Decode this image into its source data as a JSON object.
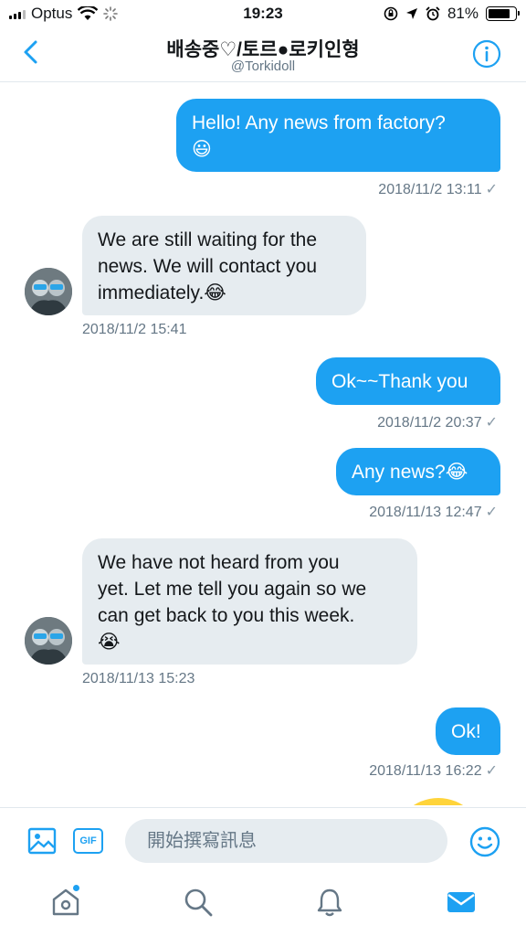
{
  "status_bar": {
    "carrier": "Optus",
    "time": "19:23",
    "battery": "81%",
    "battery_level": 0.81
  },
  "header": {
    "title": "배송중♡/토르●로키인형",
    "handle": "@Torkidoll"
  },
  "messages": [
    {
      "type": "sent",
      "lines": [
        "Hello! Any news from factory?",
        "😃"
      ],
      "timestamp": "2018/11/2 13:11"
    },
    {
      "type": "received",
      "lines": [
        "We are still waiting for the",
        "news. We will contact you",
        "immediately.😂"
      ],
      "timestamp": "2018/11/2 15:41"
    },
    {
      "type": "sent",
      "lines": [
        "Ok~~Thank you"
      ],
      "timestamp": "2018/11/2 20:37"
    },
    {
      "type": "sent",
      "lines": [
        "Any news?😂"
      ],
      "timestamp": "2018/11/13 12:47"
    },
    {
      "type": "received",
      "lines": [
        "We have not heard from you",
        "yet. Let me tell you again so we",
        "can get back to you this week.",
        "😭"
      ],
      "timestamp": "2018/11/13 15:23"
    },
    {
      "type": "sent",
      "lines": [
        "Ok!"
      ],
      "timestamp": "2018/11/13 16:22"
    }
  ],
  "composer": {
    "gif_label": "GIF",
    "placeholder": "開始撰寫訊息"
  },
  "colors": {
    "accent": "#1da1f2",
    "received_bubble": "#e6ecf0"
  }
}
